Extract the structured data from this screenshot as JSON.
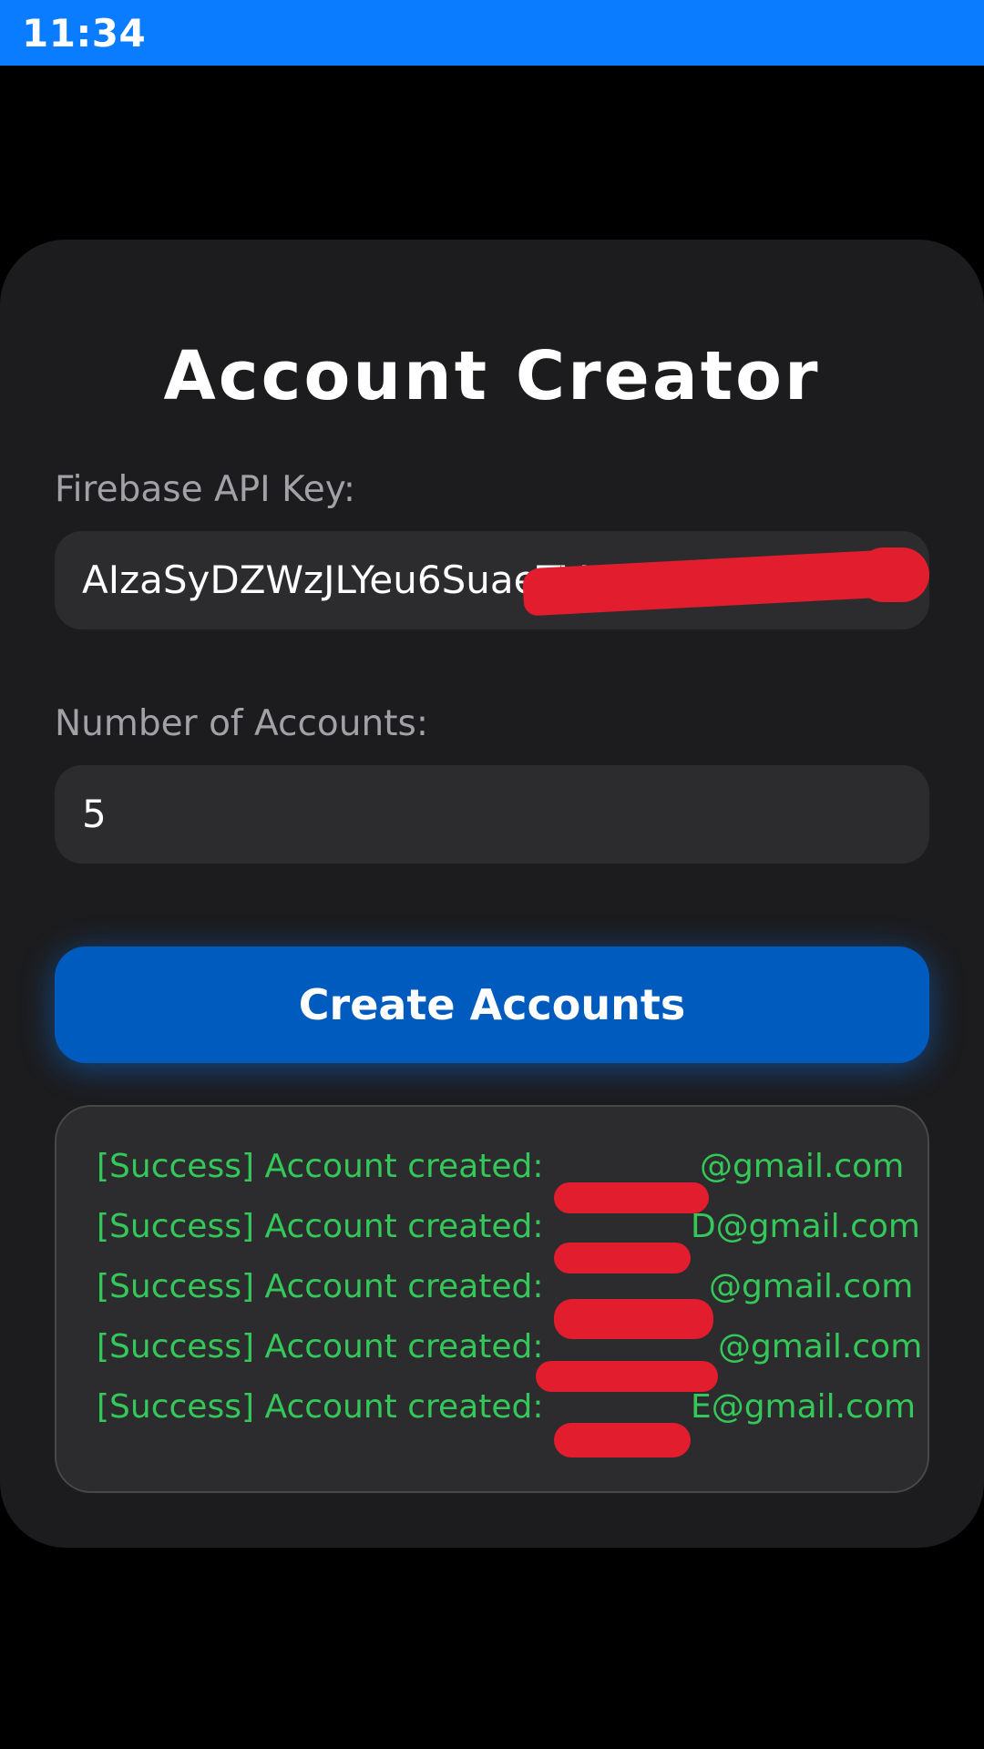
{
  "status_bar": {
    "time": "11:34",
    "color": "#0a7cff"
  },
  "app": {
    "title": "Account Creator"
  },
  "form": {
    "api_key_label": "Firebase API Key:",
    "api_key_value": "AIzaSyDZWzJLYeu6SuaeTV",
    "count_label": "Number of Accounts:",
    "count_value": "5",
    "submit_label": "Create Accounts"
  },
  "log": {
    "entries": [
      {
        "prefix": "[Success] Account created: ",
        "suffix": "@gmail.com"
      },
      {
        "prefix": "[Success] Account created: ",
        "suffix": "D@gmail.com"
      },
      {
        "prefix": "[Success] Account created: ",
        "suffix": "@gmail.com"
      },
      {
        "prefix": "[Success] Account created: ",
        "suffix": "@gmail.com"
      },
      {
        "prefix": "[Success] Account created: ",
        "suffix": "E@gmail.com"
      }
    ]
  },
  "colors": {
    "accent": "#005bbf",
    "success_text": "#34c759",
    "redaction": "#e11d2e",
    "card_bg": "#1c1c1e",
    "field_bg": "#2c2c2e"
  }
}
